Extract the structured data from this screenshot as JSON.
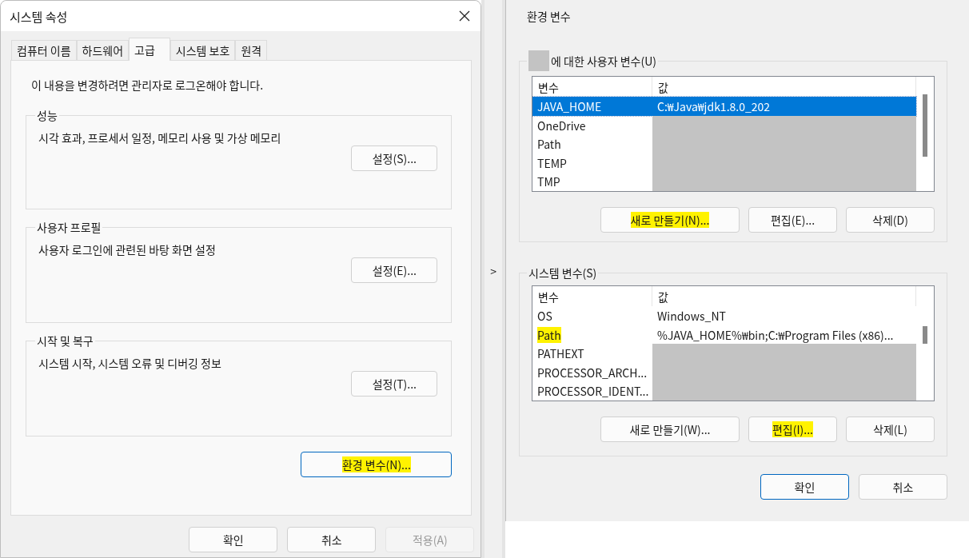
{
  "system_properties": {
    "title": "시스템 속성",
    "tabs": [
      {
        "label": "컴퓨터 이름",
        "selected": false
      },
      {
        "label": "하드웨어",
        "selected": false
      },
      {
        "label": "고급",
        "selected": true
      },
      {
        "label": "시스템 보호",
        "selected": false
      },
      {
        "label": "원격",
        "selected": false
      }
    ],
    "notice": "이 내용을 변경하려면 관리자로 로그온해야 합니다.",
    "groups": [
      {
        "title": "성능",
        "description": "시각 효과, 프로세서 일정, 메모리 사용 및 가상 메모리",
        "button": "설정(S)..."
      },
      {
        "title": "사용자 프로필",
        "description": "사용자 로그인에 관련된 바탕 화면 설정",
        "button": "설정(E)..."
      },
      {
        "title": "시작 및 복구",
        "description": "시스템 시작, 시스템 오류 및 디버깅 정보",
        "button": "설정(T)..."
      }
    ],
    "env_button": {
      "label": "환경 변수(N)...",
      "highlighted": true
    },
    "buttons": [
      {
        "label": "확인",
        "disabled": false
      },
      {
        "label": "취소",
        "disabled": false
      },
      {
        "label": "적용(A)",
        "disabled": true
      }
    ]
  },
  "arrow": ">",
  "environment_variables": {
    "title": "환경 변수",
    "user_vars": {
      "title": "에 대한 사용자 변수(U)",
      "user_name_hidden": true,
      "columns": [
        "변수",
        "값"
      ],
      "rows": [
        {
          "name": "JAVA_HOME",
          "value": "C:₩Java₩jdk1.8.0_202",
          "selected": true,
          "highlighted": false,
          "value_hidden": false
        },
        {
          "name": "OneDrive",
          "selected": false,
          "highlighted": false,
          "value_hidden": true
        },
        {
          "name": "Path",
          "selected": false,
          "highlighted": false,
          "value_hidden": true
        },
        {
          "name": "TEMP",
          "selected": false,
          "highlighted": false,
          "value_hidden": true
        },
        {
          "name": "TMP",
          "selected": false,
          "highlighted": false,
          "value_hidden": true
        }
      ],
      "buttons": [
        {
          "label": "새로 만들기(N)...",
          "highlighted": true
        },
        {
          "label": "편집(E)...",
          "highlighted": false
        },
        {
          "label": "삭제(D)",
          "highlighted": false
        }
      ]
    },
    "system_vars": {
      "title": "시스템 변수(S)",
      "columns": [
        "변수",
        "값"
      ],
      "rows": [
        {
          "name": "OS",
          "value": "Windows_NT",
          "selected": false,
          "highlighted": false,
          "value_hidden": false
        },
        {
          "name": "Path",
          "value": "%JAVA_HOME%₩bin;C:₩Program Files (x86)...",
          "selected": false,
          "highlighted": true,
          "value_hidden": false
        },
        {
          "name": "PATHEXT",
          "selected": false,
          "highlighted": false,
          "value_hidden": true
        },
        {
          "name": "PROCESSOR_ARCH...",
          "selected": false,
          "highlighted": false,
          "value_hidden": true
        },
        {
          "name": "PROCESSOR_IDENT...",
          "selected": false,
          "highlighted": false,
          "value_hidden": true
        }
      ],
      "buttons": [
        {
          "label": "새로 만들기(W)...",
          "highlighted": false
        },
        {
          "label": "편집(I)...",
          "highlighted": true
        },
        {
          "label": "삭제(L)",
          "highlighted": false
        }
      ]
    },
    "buttons": [
      {
        "label": "확인",
        "default": true
      },
      {
        "label": "취소",
        "default": false
      }
    ]
  }
}
